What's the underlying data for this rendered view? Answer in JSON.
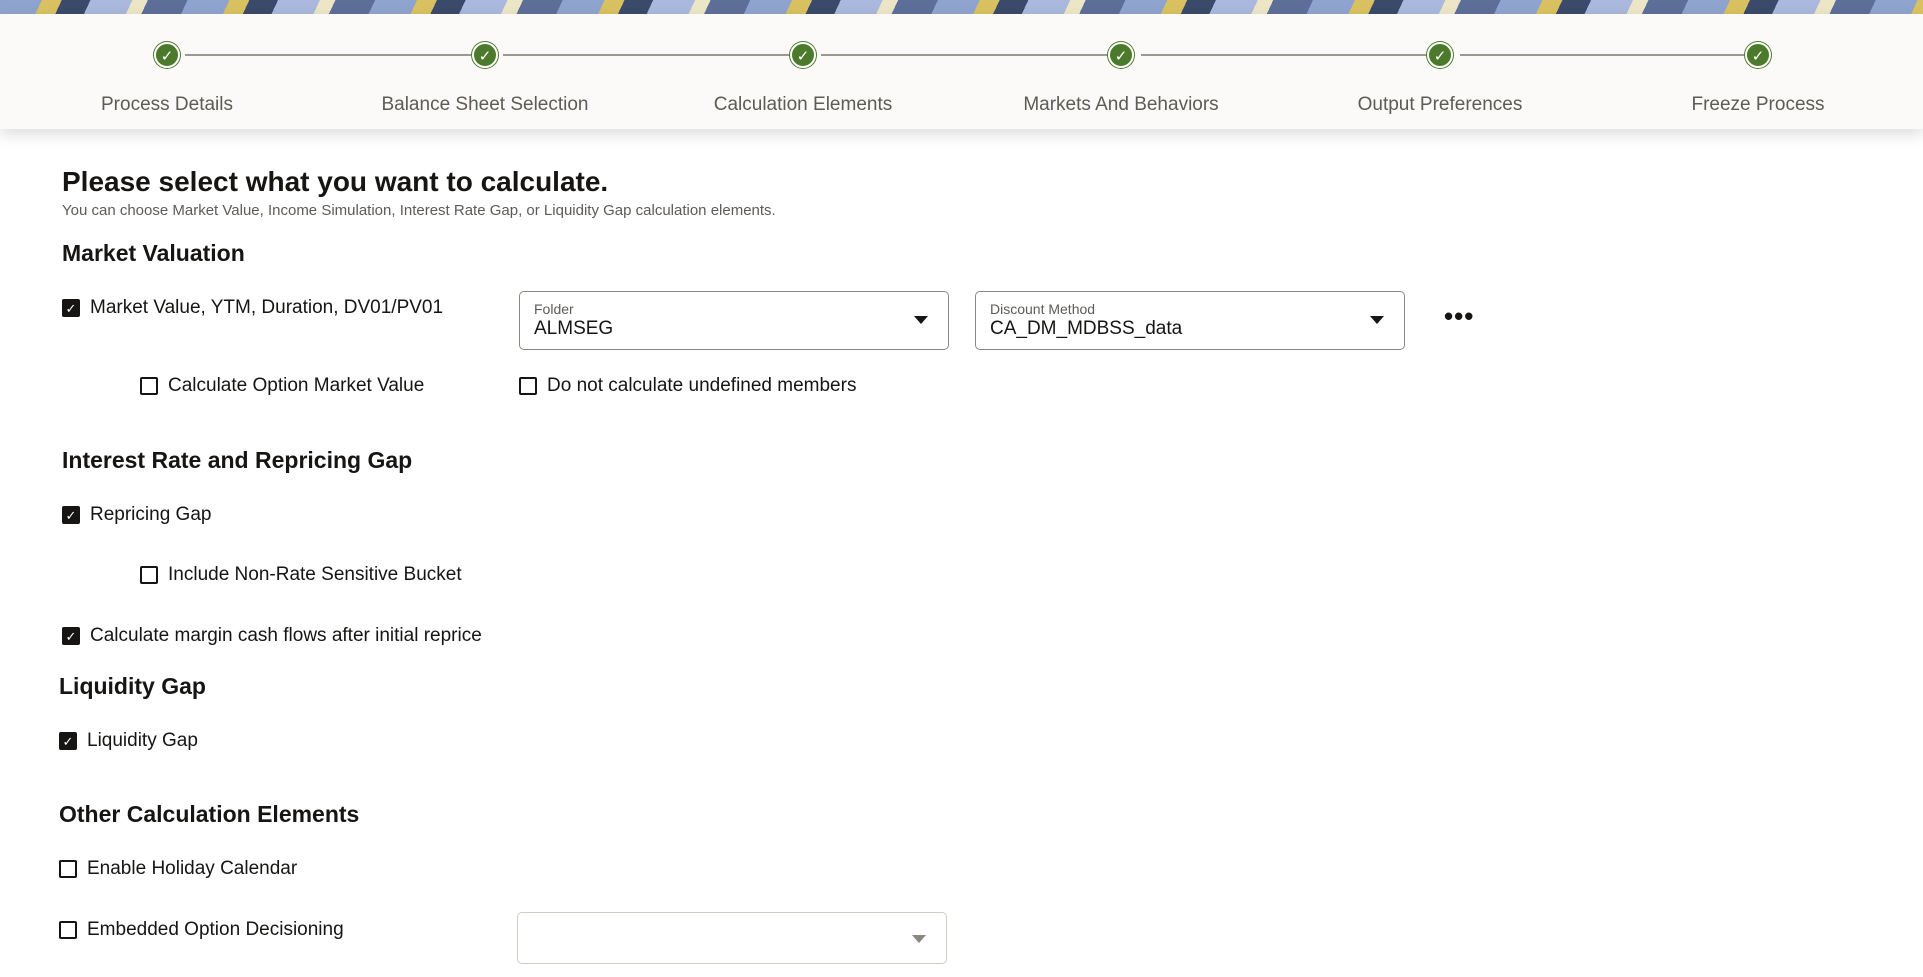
{
  "train": {
    "steps": [
      {
        "label": "Process Details",
        "icon": "check-icon"
      },
      {
        "label": "Balance Sheet Selection",
        "icon": "check-icon"
      },
      {
        "label": "Calculation Elements",
        "icon": "check-icon"
      },
      {
        "label": "Markets And Behaviors",
        "icon": "check-icon"
      },
      {
        "label": "Output Preferences",
        "icon": "check-icon"
      },
      {
        "label": "Freeze Process",
        "icon": "check-icon"
      }
    ],
    "glyph": "✓"
  },
  "page": {
    "title": "Please select what you want to calculate.",
    "subtitle": "You can choose Market Value, Income Simulation, Interest Rate Gap, or Liquidity Gap calculation elements."
  },
  "market_valuation": {
    "heading": "Market Valuation",
    "mv_checkbox": {
      "label": "Market Value, YTM, Duration, DV01/PV01",
      "checked": true
    },
    "folder": {
      "label": "Folder",
      "value": "ALMSEG"
    },
    "discount_method": {
      "label": "Discount Method",
      "value": "CA_DM_MDBSS_data"
    },
    "more_label": "•••",
    "option_mv": {
      "label": "Calculate Option Market Value",
      "checked": false
    },
    "undefined_members": {
      "label": "Do not calculate undefined members",
      "checked": false
    }
  },
  "repricing": {
    "heading": "Interest Rate and Repricing Gap",
    "repricing_gap": {
      "label": "Repricing Gap",
      "checked": true
    },
    "non_rate_bucket": {
      "label": "Include Non-Rate Sensitive Bucket",
      "checked": false
    },
    "margin_cash_flows": {
      "label": "Calculate margin cash flows after initial reprice",
      "checked": true
    }
  },
  "liquidity": {
    "heading": "Liquidity Gap",
    "liquidity_gap": {
      "label": "Liquidity Gap",
      "checked": true
    }
  },
  "other": {
    "heading": "Other Calculation Elements",
    "holiday_calendar": {
      "label": "Enable Holiday Calendar",
      "checked": false
    },
    "embedded_option": {
      "label": "Embedded Option Decisioning",
      "checked": false
    },
    "embedded_option_select": {
      "value": ""
    }
  },
  "check_glyph": "✓",
  "colors": {
    "accent_green": "#4c7a2c",
    "text": "#161513",
    "muted": "#5e5b57"
  }
}
